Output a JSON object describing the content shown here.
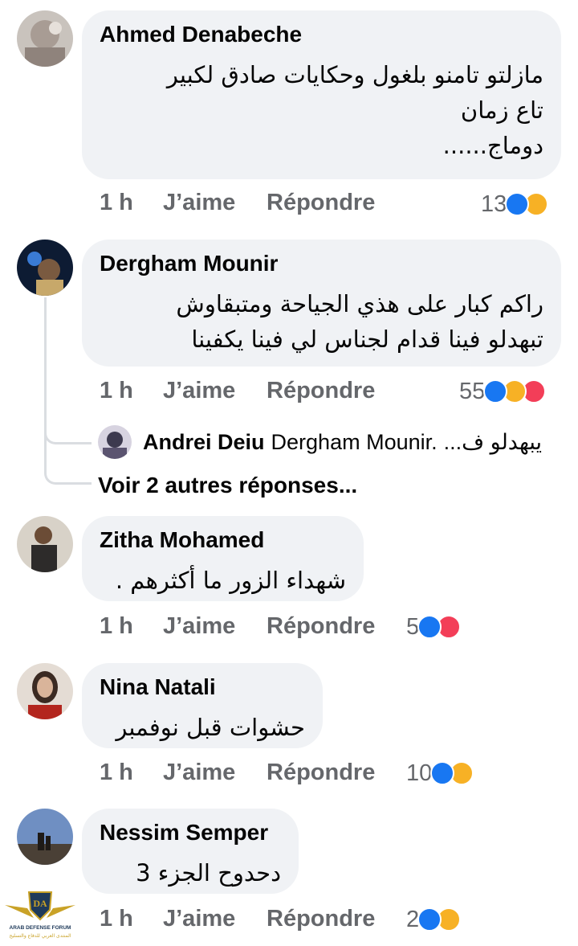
{
  "comments": [
    {
      "author": "Ahmed Denabeche",
      "text": "مازلتو تامنو بلغول وحكايات صادق لكبير\nتاع زمان\nدوماج......",
      "time": "1 h",
      "like_label": "J’aime",
      "reply_label": "Répondre",
      "reaction_count": "13",
      "reactions": [
        "like-icon",
        "haha-icon"
      ]
    },
    {
      "author": "Dergham Mounir",
      "text": "راكم كبار على هذي الجياحة ومتبقاوش\nتبهدلو فينا قدام لجناس لي فينا يكفينا",
      "time": "1 h",
      "like_label": "J’aime",
      "reply_label": "Répondre",
      "reaction_count": "55",
      "reactions": [
        "like-icon",
        "haha-icon",
        "love-icon"
      ]
    },
    {
      "author": "Zitha Mohamed",
      "text": "شهداء الزور ما أكثرهم .",
      "time": "1 h",
      "like_label": "J’aime",
      "reply_label": "Répondre",
      "reaction_count": "5",
      "reactions": [
        "like-icon",
        "love-icon"
      ]
    },
    {
      "author": "Nina Natali",
      "text": "حشوات قبل نوفمبر",
      "time": "1 h",
      "like_label": "J’aime",
      "reply_label": "Répondre",
      "reaction_count": "10",
      "reactions": [
        "like-icon",
        "haha-icon"
      ]
    },
    {
      "author": "Nessim Semper",
      "text": "دحدوح الجزء 3",
      "time": "1 h",
      "like_label": "J’aime",
      "reply_label": "Répondre",
      "reaction_count": "2",
      "reactions": [
        "like-icon",
        "haha-icon"
      ]
    }
  ],
  "reply_preview": {
    "author": "Andrei Deiu",
    "text": "Dergham Mounir. يبهدلو ف...",
    "mention": "Dergham Mounir.",
    "snippet": "يبهدلو ف..."
  },
  "more_replies_label": "Voir 2 autres réponses...",
  "watermark": {
    "logo_text": "DA",
    "line1": "ARAB DEFENSE FORUM",
    "line2": "المنتدى العربي للدفاع والتسليح"
  },
  "colors": {
    "bubble": "#f0f2f5",
    "meta_text": "#65676b",
    "like": "#1877f2",
    "haha": "#f7b125",
    "love": "#f33e58"
  }
}
